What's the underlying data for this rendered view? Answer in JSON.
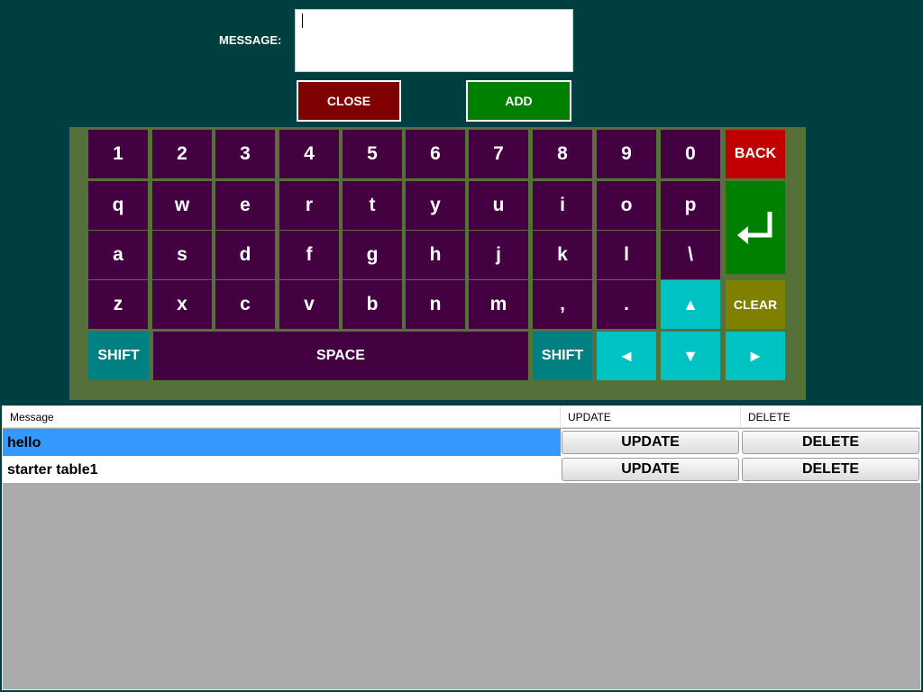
{
  "form": {
    "message_label": "MESSAGE:",
    "message_value": "",
    "close_label": "CLOSE",
    "add_label": "ADD"
  },
  "keyboard": {
    "row1": [
      "1",
      "2",
      "3",
      "4",
      "5",
      "6",
      "7",
      "8",
      "9",
      "0"
    ],
    "back_label": "BACK",
    "row2": [
      "q",
      "w",
      "e",
      "r",
      "t",
      "y",
      "u",
      "i",
      "o",
      "p"
    ],
    "row3": [
      "a",
      "s",
      "d",
      "f",
      "g",
      "h",
      "j",
      "k",
      "l",
      "\\"
    ],
    "row4": [
      "z",
      "x",
      "c",
      "v",
      "b",
      "n",
      "m",
      ",",
      "."
    ],
    "up_arrow": "▲",
    "clear_label": "CLEAR",
    "shift_label": "SHIFT",
    "space_label": "SPACE",
    "left_arrow": "◄",
    "down_arrow": "▼",
    "right_arrow": "►",
    "enter_symbol": "↵",
    "colors": {
      "key": "#430141",
      "board": "#56703a",
      "shift": "#008080",
      "arrow": "#00c2c2",
      "back": "#c00000",
      "enter": "#008000",
      "clear": "#7f7f00"
    }
  },
  "table": {
    "columns": [
      "Message",
      "UPDATE",
      "DELETE"
    ],
    "rows": [
      {
        "message": "hello",
        "update": "UPDATE",
        "delete": "DELETE",
        "selected": true
      },
      {
        "message": "starter table1",
        "update": "UPDATE",
        "delete": "DELETE",
        "selected": false
      }
    ]
  }
}
